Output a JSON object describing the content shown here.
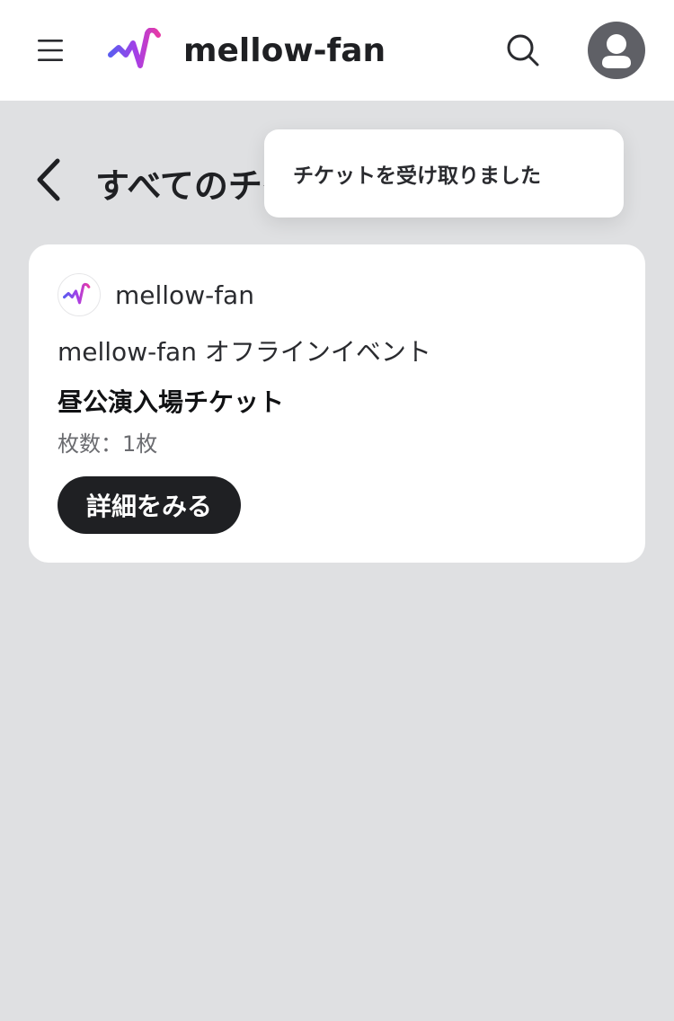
{
  "header": {
    "brand": "mellow-fan",
    "menu_icon": "hamburger-menu-icon",
    "search_icon": "search-icon",
    "avatar_icon": "user-avatar-icon"
  },
  "page": {
    "title": "すべてのチケット",
    "back_icon": "chevron-left-icon"
  },
  "ticket_card": {
    "organizer": "mellow-fan",
    "event_name": "mellow-fan オフラインイベント",
    "ticket_name": "昼公演入場チケット",
    "count_text": "枚数：1枚",
    "detail_button_label": "詳細をみる"
  },
  "toast": {
    "message": "チケットを受け取りました"
  },
  "colors": {
    "background": "#dfe0e2",
    "surface": "#ffffff",
    "primary_dark": "#1f2023",
    "avatar_bg": "#5f6066",
    "logo_gradient_start": "#5b5cf0",
    "logo_gradient_end": "#e63aa6"
  }
}
